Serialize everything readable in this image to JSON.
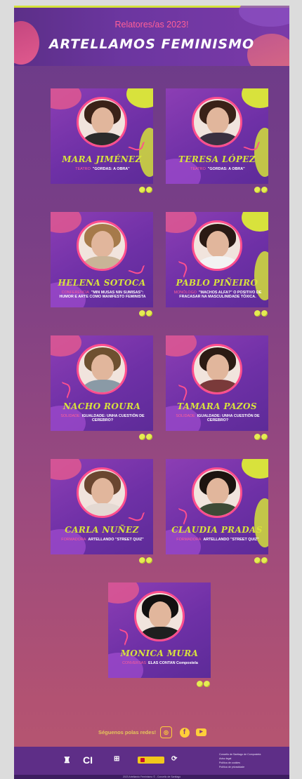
{
  "hero": {
    "subtitle": "Relatores/as 2023!",
    "title": "ARTELLAMOS FEMINISMO"
  },
  "speakers": [
    {
      "name": "MARA JIMÉNEZ",
      "kind": "TEATRO",
      "talk": "\"GORDAS: A OBRA\""
    },
    {
      "name": "TERESA LÓPEZ",
      "kind": "TEATRO",
      "talk": "\"GORDAS: A OBRA\""
    },
    {
      "name": "HELENA SOTOCA",
      "kind": "CONFERENCIA",
      "talk": "\"MIN MUSAS NIN SUMISAS\": HUMOR E ARTE COMO MANIFESTO FEMINISTA"
    },
    {
      "name": "PABLO PIÑEIRO",
      "kind": "MONÓLOGO",
      "talk": "\"MACHOS ALFA?\" O POSITIVO DE FRACASAR NA MASCULINIDADE TÓXICA."
    },
    {
      "name": "NACHO ROURA",
      "kind": "SOLIDADE",
      "talk": "IGUALDADE: UNHA CUESTIÓN DE CEREBRO?"
    },
    {
      "name": "TAMARA PAZOS",
      "kind": "SOLIDADE",
      "talk": "IGUALDADE: UNHA CUESTIÓN DE CEREBRO?"
    },
    {
      "name": "CARLA NUÑEZ",
      "kind": "FORMADORA",
      "talk": "ARTELLANDO \"STREET QUIZ\""
    },
    {
      "name": "CLAUDIA PRADAS",
      "kind": "FORMADORA",
      "talk": "ARTELLANDO \"STREET QUIZ\""
    },
    {
      "name": "MONICA MURA",
      "kind": "CONVERSAS",
      "talk": "ELAS CONTAN Compostela"
    }
  ],
  "social": {
    "label": "Séguenos polas redes!",
    "icons": [
      "instagram-icon",
      "facebook-icon",
      "youtube-icon"
    ]
  },
  "footer": {
    "logos": [
      "Concello de Santiago",
      "CIM",
      "Universidade",
      "Gobierno de España",
      "Xunta"
    ],
    "links": [
      "Concello de Santiago de Compostela",
      "Aviso legal",
      "Política de cookies",
      "Política de privacidade"
    ],
    "copyright": "2023 Artellando Feminismo © - Concello de Santiago"
  },
  "colors": {
    "accent_yellow": "#d8e23c",
    "accent_pink": "#ff4f8e",
    "card_purple": "#6e30a6"
  }
}
